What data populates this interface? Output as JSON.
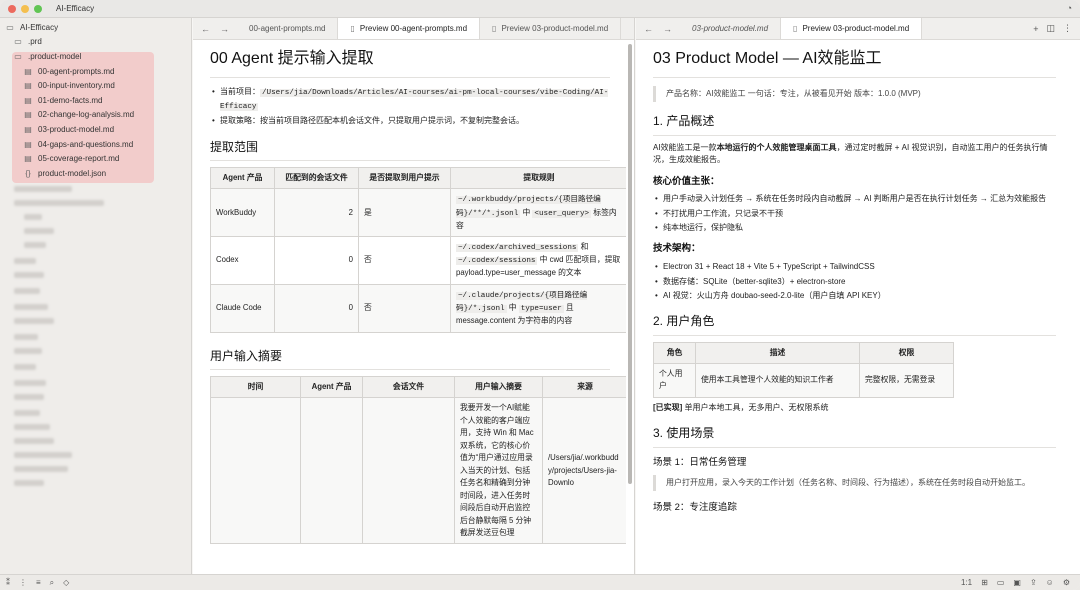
{
  "window": {
    "title": "AI-Efficacy"
  },
  "sidebar": {
    "root": "AI-Efficacy",
    "items": [
      {
        "label": ".prd",
        "icon": "folder-icon"
      },
      {
        "label": ".product-model",
        "icon": "folder-open-icon"
      },
      {
        "label": "00-agent-prompts.md",
        "icon": "markdown-file-icon"
      },
      {
        "label": "00-input-inventory.md",
        "icon": "markdown-file-icon"
      },
      {
        "label": "01-demo-facts.md",
        "icon": "markdown-file-icon"
      },
      {
        "label": "02-change-log-analysis.md",
        "icon": "markdown-file-icon"
      },
      {
        "label": "03-product-model.md",
        "icon": "markdown-file-icon"
      },
      {
        "label": "04-gaps-and-questions.md",
        "icon": "markdown-file-icon"
      },
      {
        "label": "05-coverage-report.md",
        "icon": "markdown-file-icon"
      },
      {
        "label": "product-model.json",
        "icon": "json-file-icon"
      }
    ]
  },
  "left_pane": {
    "tabs": [
      "00-agent-prompts.md",
      "Preview 00-agent-prompts.md",
      "Preview 03-product-model.md"
    ],
    "title": "00 Agent 提示输入提取",
    "bullet1_label": "当前项目：",
    "bullet1_code": "/Users/jia/Downloads/Articles/AI-courses/ai-pm-local-courses/vibe-Coding/AI-Efficacy",
    "bullet2": "提取策略：按当前项目路径匹配本机会话文件，只提取用户提示词，不复制完整会话。",
    "section1": "提取范围",
    "table1": {
      "headers": [
        "Agent 产品",
        "匹配到的会话文件",
        "是否提取到用户提示",
        "提取规则"
      ],
      "rows": [
        {
          "agent": "WorkBuddy",
          "count": "2",
          "extracted": "是",
          "rule_code1": "~/.workbuddy/projects/{项目路径编码}/**/*.jsonl",
          "rule_mid": " 中 ",
          "rule_code2": "<user_query>",
          "rule_tail": " 标签内容"
        },
        {
          "agent": "Codex",
          "count": "0",
          "extracted": "否",
          "rule_code1": "~/.codex/archived_sessions",
          "rule_mid": " 和 ",
          "rule_code2": "~/.codex/sessions",
          "rule_tail": " 中 cwd 匹配项目，提取 payload.type=user_message 的文本"
        },
        {
          "agent": "Claude Code",
          "count": "0",
          "extracted": "否",
          "rule_code1": "~/.claude/projects/{项目路径编码}/*.jsonl",
          "rule_mid": " 中 ",
          "rule_code2": "type=user",
          "rule_tail": " 且 message.content 为字符串的内容"
        }
      ]
    },
    "section2": "用户输入摘要",
    "table2": {
      "headers": [
        "时间",
        "Agent 产品",
        "会话文件",
        "用户输入摘要",
        "来源"
      ],
      "summary": "我要开发一个AI赋能个人效能的客户端应用，支持 Win 和 Mac 双系统，它的核心价值为“用户通过应用录入当天的计划、包括任务名和精确到分钟时间段，进入任务时间段后自动开启监控后台静默每隔 5 分钟截屏发送豆包理",
      "source": "/Users/jia/.workbuddy/projects/Users-jia-Downlo"
    }
  },
  "right_pane": {
    "tabs": [
      "03-product-model.md",
      "Preview 03-product-model.md"
    ],
    "title": "03 Product Model — AI效能监工",
    "quote": "产品名称：AI效能监工 一句话：专注，从被看见开始 版本：1.0.0 (MVP)",
    "h_overview": "1. 产品概述",
    "overview_pre": "AI效能监工是一款",
    "overview_bold": "本地运行的个人效能管理桌面工具",
    "overview_post": "，通过定时截屏 + AI 视觉识别，自动监工用户的任务执行情况，生成效能报告。",
    "core_title": "核心价值主张：",
    "core_items": [
      "用户手动录入计划任务 → 系统在任务时段内自动截屏 → AI 判断用户是否在执行计划任务 → 汇总为效能报告",
      "不打扰用户工作流，只记录不干预",
      "纯本地运行，保护隐私"
    ],
    "tech_title": "技术架构：",
    "tech_items": [
      "Electron 31 + React 18 + Vite 5 + TypeScript + TailwindCSS",
      "数据存储：SQLite（better-sqlite3）+ electron-store",
      "AI 视觉：火山方舟 doubao-seed-2.0-lite（用户自填 API KEY）"
    ],
    "h_roles": "2. 用户角色",
    "roles_table": {
      "headers": [
        "角色",
        "描述",
        "权限"
      ],
      "rows": [
        [
          "个人用户",
          "使用本工具管理个人效能的知识工作者",
          "完整权限，无需登录"
        ]
      ]
    },
    "roles_note_bold": "[已实现]",
    "roles_note": " 单用户本地工具，无多用户、无权限系统",
    "h_scenes": "3. 使用场景",
    "scene1": "场景 1：日常任务管理",
    "scene1_text": "用户打开应用，录入今天的工作计划（任务名称、时间段、行为描述），系统在任务时段自动开始监工。",
    "scene2": "场景 2：专注度追踪"
  },
  "statusbar": {
    "zoom": "1:1"
  },
  "colors": {
    "highlight": "#f2c6c6",
    "traffic_red": "#ec6a5e",
    "traffic_yellow": "#f4bf4f",
    "traffic_green": "#61c554"
  }
}
